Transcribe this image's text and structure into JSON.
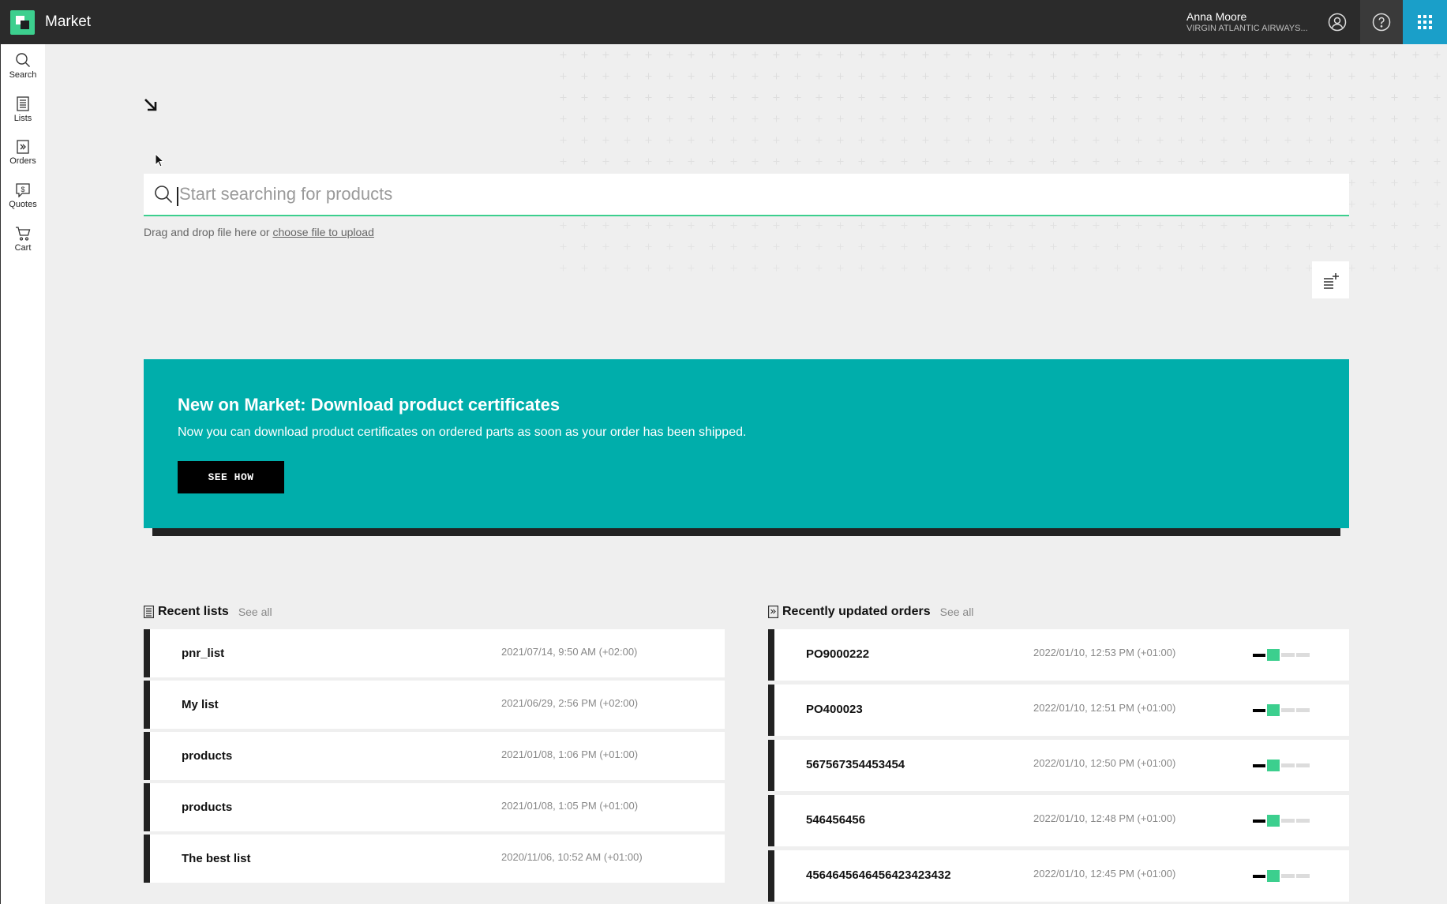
{
  "app": {
    "title": "Market"
  },
  "user": {
    "name": "Anna Moore",
    "org": "VIRGIN ATLANTIC AIRWAYS..."
  },
  "sidebar": {
    "items": [
      {
        "label": "Search",
        "icon": "search-icon"
      },
      {
        "label": "Lists",
        "icon": "list-icon"
      },
      {
        "label": "Orders",
        "icon": "orders-icon"
      },
      {
        "label": "Quotes",
        "icon": "quotes-icon"
      },
      {
        "label": "Cart",
        "icon": "cart-icon"
      }
    ]
  },
  "search": {
    "placeholder": "Start searching for products",
    "drop_hint": "Drag and drop file here or",
    "upload_link": "choose file to upload"
  },
  "banner": {
    "title": "New on Market: Download product certificates",
    "text": "Now you can download product certificates on ordered parts as soon as your order has been shipped.",
    "button": "SEE HOW"
  },
  "recent_lists": {
    "title": "Recent lists",
    "see_all": "See all",
    "items": [
      {
        "name": "pnr_list",
        "date": "2021/07/14, 9:50 AM (+02:00)"
      },
      {
        "name": "My list",
        "date": "2021/06/29, 2:56 PM (+02:00)"
      },
      {
        "name": "products",
        "date": "2021/01/08, 1:06 PM (+01:00)"
      },
      {
        "name": "products",
        "date": "2021/01/08, 1:05 PM (+01:00)"
      },
      {
        "name": "The best list",
        "date": "2020/11/06, 10:52 AM (+01:00)"
      }
    ]
  },
  "recent_orders": {
    "title": "Recently updated orders",
    "see_all": "See all",
    "items": [
      {
        "name": "PO9000222",
        "date": "2022/01/10, 12:53 PM (+01:00)",
        "progress_step": 2,
        "progress_total": 4
      },
      {
        "name": "PO400023",
        "date": "2022/01/10, 12:51 PM (+01:00)",
        "progress_step": 2,
        "progress_total": 4
      },
      {
        "name": "567567354453454",
        "date": "2022/01/10, 12:50 PM (+01:00)",
        "progress_step": 2,
        "progress_total": 4
      },
      {
        "name": "546456456",
        "date": "2022/01/10, 12:48 PM (+01:00)",
        "progress_step": 2,
        "progress_total": 4
      },
      {
        "name": "4564645646456423423432",
        "date": "2022/01/10, 12:45 PM (+01:00)",
        "progress_step": 2,
        "progress_total": 4
      }
    ]
  },
  "colors": {
    "accent": "#3ccf8e",
    "banner": "#00aeab",
    "topbar": "#2b2b2b",
    "apps": "#1a9fc9"
  }
}
